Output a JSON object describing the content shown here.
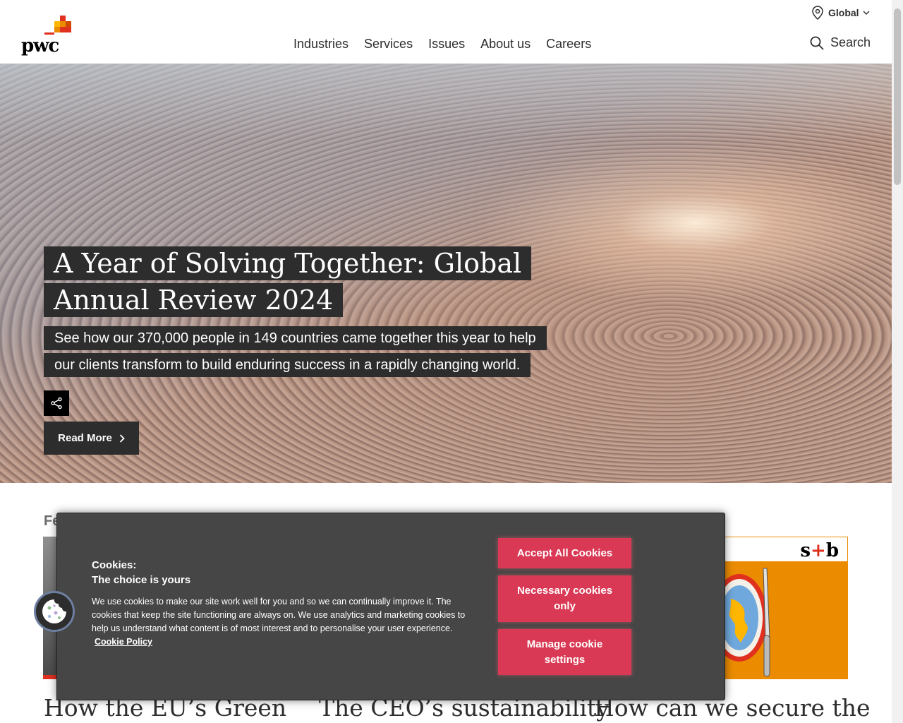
{
  "brand": {
    "name": "pwc",
    "colors": {
      "orange": "#eb8c00",
      "red": "#e0301e",
      "rose": "#d93954",
      "dark": "#2d2d2d"
    }
  },
  "header": {
    "region": "Global",
    "nav": [
      "Industries",
      "Services",
      "Issues",
      "About us",
      "Careers"
    ],
    "search_label": "Search"
  },
  "hero": {
    "title": "A Year of Solving Together: Global Annual Review 2024",
    "description": "See how our 370,000 people in 149 countries came together this year to help our clients transform to build enduring success in a rapidly changing world.",
    "read_more": "Read More",
    "share_icon": "share-icon"
  },
  "featured": {
    "label": "Fe",
    "card1_title": "How the EU’s Green",
    "card2_title": "The CEO’s sustainability",
    "card3_title": "How can we secure the",
    "card3_logo": {
      "left": "s",
      "plus": "+",
      "right": "b"
    }
  },
  "cookie_banner": {
    "heading": "Cookies:",
    "subheading": "The choice is yours",
    "body": "We use cookies to make our site work well for you and so we can continually improve it. The cookies that keep the site functioning are always on. We use analytics and marketing cookies to help us understand what content is of most interest and to personalise your user experience.",
    "policy_link": "Cookie Policy",
    "accept_all": "Accept All Cookies",
    "necessary_only": "Necessary cookies only",
    "manage": "Manage cookie settings"
  }
}
